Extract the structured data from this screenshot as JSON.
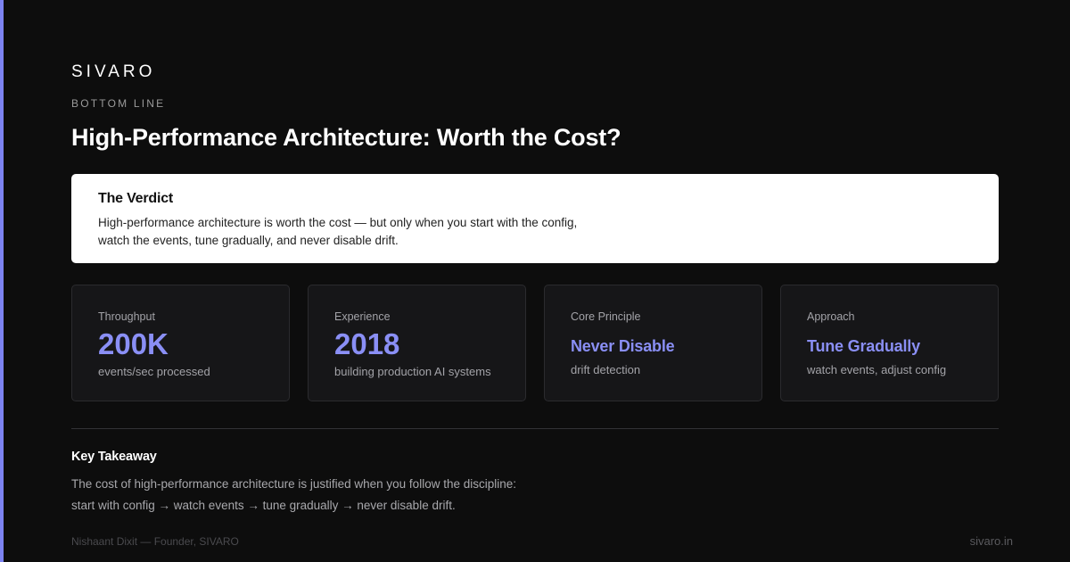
{
  "brand": "SIVARO",
  "eyebrow": "BOTTOM LINE",
  "title": "High-Performance Architecture: Worth the Cost?",
  "verdict": {
    "heading": "The Verdict",
    "line1": "High-performance architecture is worth the cost — but only when you start with the config,",
    "line2": "watch the events, tune gradually, and never disable drift."
  },
  "cards": [
    {
      "label": "Throughput",
      "value": "200K",
      "sub": "events/sec processed"
    },
    {
      "label": "Experience",
      "value": "2018",
      "sub": "building production AI systems"
    },
    {
      "label": "Core Principle",
      "value": "Never Disable",
      "sub": "drift detection"
    },
    {
      "label": "Approach",
      "value": "Tune Gradually",
      "sub": "watch events, adjust config"
    }
  ],
  "takeaway": {
    "heading": "Key Takeaway",
    "line1": "The cost of high-performance architecture is justified when you follow the discipline:",
    "line2": "start with config → watch events → tune gradually → never disable drift."
  },
  "footer": {
    "author": "Nishaant Dixit — Founder, SIVARO",
    "site": "sivaro.in"
  },
  "colors": {
    "accent": "#7c83f0",
    "background": "#0d0d0d",
    "card": "#161618"
  }
}
